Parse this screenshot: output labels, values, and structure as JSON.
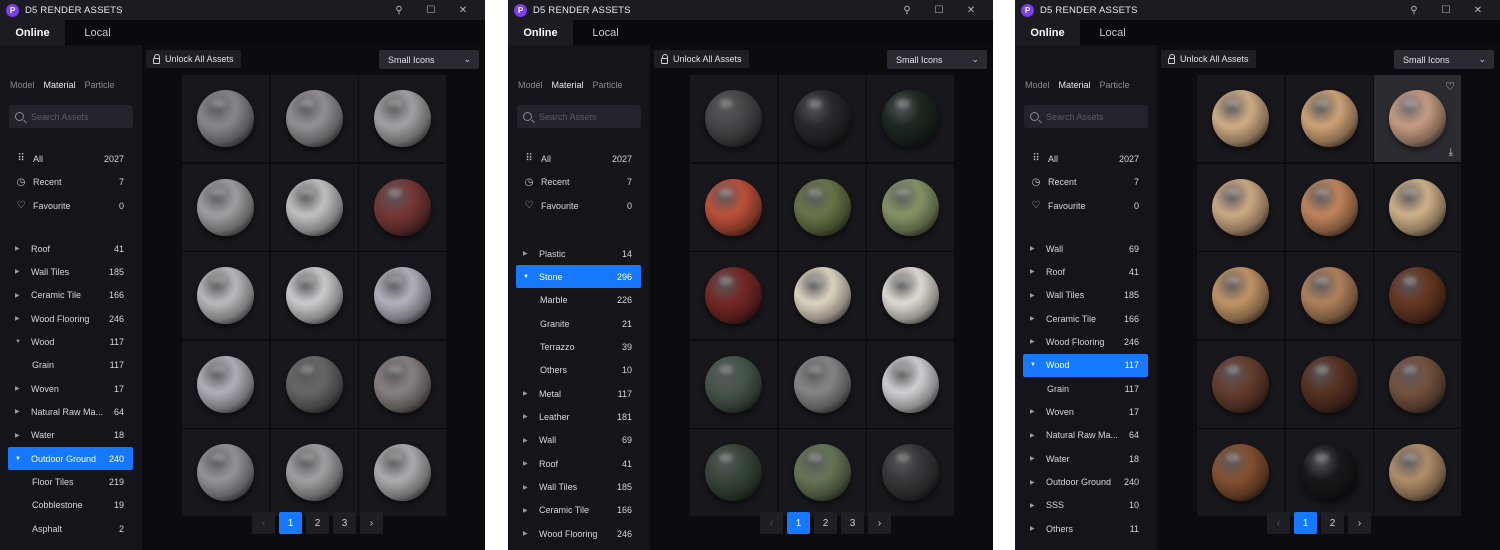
{
  "app_title": "D5 RENDER ASSETS",
  "logo_letter": "P",
  "tabs": [
    "Online",
    "Local"
  ],
  "asset_tabs": [
    "Model",
    "Material",
    "Particle"
  ],
  "search_placeholder": "Search Assets",
  "unlock_label": "Unlock All Assets",
  "view_label": "Small Icons",
  "nav_items": [
    {
      "label": "All",
      "count": "2027",
      "icon": "grid-icon"
    },
    {
      "label": "Recent",
      "count": "7",
      "icon": "clock-icon"
    },
    {
      "label": "Favourite",
      "count": "0",
      "icon": "heart-icon"
    }
  ],
  "panels": [
    {
      "categories": [
        {
          "label": "Roof",
          "count": "41",
          "level": "top",
          "arrow": "collapsed"
        },
        {
          "label": "Wall Tiles",
          "count": "185",
          "level": "top",
          "arrow": "collapsed"
        },
        {
          "label": "Ceramic Tile",
          "count": "166",
          "level": "top",
          "arrow": "collapsed"
        },
        {
          "label": "Wood Flooring",
          "count": "246",
          "level": "top",
          "arrow": "collapsed"
        },
        {
          "label": "Wood",
          "count": "117",
          "level": "top",
          "arrow": "expanded"
        },
        {
          "label": "Grain",
          "count": "117",
          "level": "sub",
          "arrow": "none"
        },
        {
          "label": "Woven",
          "count": "17",
          "level": "top",
          "arrow": "collapsed"
        },
        {
          "label": "Natural Raw Ma...",
          "count": "64",
          "level": "top",
          "arrow": "collapsed"
        },
        {
          "label": "Water",
          "count": "18",
          "level": "top",
          "arrow": "collapsed"
        },
        {
          "label": "Outdoor Ground",
          "count": "240",
          "level": "top",
          "arrow": "expanded",
          "selected": true
        },
        {
          "label": "Floor Tiles",
          "count": "219",
          "level": "sub",
          "arrow": "none"
        },
        {
          "label": "Cobblestone",
          "count": "19",
          "level": "sub",
          "arrow": "none"
        },
        {
          "label": "Asphalt",
          "count": "2",
          "level": "sub",
          "arrow": "none"
        }
      ],
      "materials": [
        "#8d8d93",
        "#9a979c",
        "#a9a9ad",
        "#a6a6aa",
        "#c9c9cc",
        "#7a3a38",
        "#c2c2c6",
        "#d4d4d8",
        "#b9bac4",
        "#b7b8c0",
        "#6c6a6c",
        "#8e8686",
        "#9a9aa0",
        "#a8a8ac",
        "#b4b4b8"
      ],
      "pages": [
        "1",
        "2",
        "3"
      ],
      "active_page": "1"
    },
    {
      "categories": [
        {
          "label": "Plastic",
          "count": "14",
          "level": "top",
          "arrow": "collapsed"
        },
        {
          "label": "Stone",
          "count": "296",
          "level": "top",
          "arrow": "expanded",
          "selected": true
        },
        {
          "label": "Marble",
          "count": "226",
          "level": "sub",
          "arrow": "none"
        },
        {
          "label": "Granite",
          "count": "21",
          "level": "sub",
          "arrow": "none"
        },
        {
          "label": "Terrazzo",
          "count": "39",
          "level": "sub",
          "arrow": "none"
        },
        {
          "label": "Others",
          "count": "10",
          "level": "sub",
          "arrow": "none"
        },
        {
          "label": "Metal",
          "count": "117",
          "level": "top",
          "arrow": "collapsed"
        },
        {
          "label": "Leather",
          "count": "181",
          "level": "top",
          "arrow": "collapsed"
        },
        {
          "label": "Wall",
          "count": "69",
          "level": "top",
          "arrow": "collapsed"
        },
        {
          "label": "Roof",
          "count": "41",
          "level": "top",
          "arrow": "collapsed"
        },
        {
          "label": "Wall Tiles",
          "count": "185",
          "level": "top",
          "arrow": "collapsed"
        },
        {
          "label": "Ceramic Tile",
          "count": "166",
          "level": "top",
          "arrow": "collapsed"
        },
        {
          "label": "Wood Flooring",
          "count": "246",
          "level": "top",
          "arrow": "collapsed"
        }
      ],
      "materials": [
        "#4a4a4e",
        "#2a2a30",
        "#1e2a22",
        "#c4543c",
        "#6c7a4a",
        "#8a9a6a",
        "#7a2a28",
        "#e6dcc8",
        "#e8e4dc",
        "#4a5a4e",
        "#8c8c8e",
        "#d8d8dc",
        "#3a4a3c",
        "#6a7a5a",
        "#3a3a3e"
      ],
      "pages": [
        "1",
        "2",
        "3"
      ],
      "active_page": "1"
    },
    {
      "categories": [
        {
          "label": "Wall",
          "count": "69",
          "level": "top",
          "arrow": "collapsed"
        },
        {
          "label": "Roof",
          "count": "41",
          "level": "top",
          "arrow": "collapsed"
        },
        {
          "label": "Wall Tiles",
          "count": "185",
          "level": "top",
          "arrow": "collapsed"
        },
        {
          "label": "Ceramic Tile",
          "count": "166",
          "level": "top",
          "arrow": "collapsed"
        },
        {
          "label": "Wood Flooring",
          "count": "246",
          "level": "top",
          "arrow": "collapsed"
        },
        {
          "label": "Wood",
          "count": "117",
          "level": "top",
          "arrow": "expanded",
          "selected": true
        },
        {
          "label": "Grain",
          "count": "117",
          "level": "sub",
          "arrow": "none"
        },
        {
          "label": "Woven",
          "count": "17",
          "level": "top",
          "arrow": "collapsed"
        },
        {
          "label": "Natural Raw Ma...",
          "count": "64",
          "level": "top",
          "arrow": "collapsed"
        },
        {
          "label": "Water",
          "count": "18",
          "level": "top",
          "arrow": "collapsed"
        },
        {
          "label": "Outdoor Ground",
          "count": "240",
          "level": "top",
          "arrow": "collapsed"
        },
        {
          "label": "SSS",
          "count": "10",
          "level": "top",
          "arrow": "collapsed"
        },
        {
          "label": "Others",
          "count": "11",
          "level": "top",
          "arrow": "collapsed"
        }
      ],
      "materials": [
        "#d9b48a",
        "#d7a97c",
        "#cfa286",
        "#d6b08a",
        "#c88a60",
        "#d9b88e",
        "#c99a6a",
        "#b88660",
        "#6a3a24",
        "#6a4030",
        "#5a3424",
        "#7a5642",
        "#8a5434",
        "#1a1a1e",
        "#b89470"
      ],
      "pages": [
        "1",
        "2"
      ],
      "active_page": "1"
    }
  ],
  "colors": {
    "accent": "#1677ff",
    "panel_bg": "#14141a",
    "grid_bg": "#0c0c10"
  }
}
